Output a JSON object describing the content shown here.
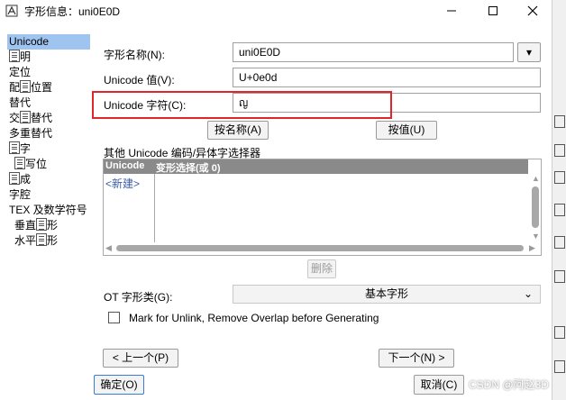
{
  "window": {
    "title": "字形信息：uni0E0D",
    "controls": {
      "minimize": "—",
      "maximize": "☐",
      "close": "✕"
    }
  },
  "sidebar": {
    "items": [
      {
        "label": "Unicode",
        "selected": true
      },
      {
        "label": "明",
        "glyph": true
      },
      {
        "label": "定位"
      },
      {
        "label": "位置",
        "prefix": "配",
        "glyph": true
      },
      {
        "label": "替代"
      },
      {
        "label": "替代",
        "prefix": "交",
        "glyph": true
      },
      {
        "label": "多重替代"
      },
      {
        "label": "字",
        "glyph": true
      },
      {
        "label": "写位",
        "glyph": true,
        "indent": true
      },
      {
        "label": "成",
        "glyph": true
      },
      {
        "label": "字腔"
      },
      {
        "label": "TEX 及数学符号"
      },
      {
        "label": "形",
        "prefix": "垂直",
        "glyph": true,
        "indent": true
      },
      {
        "label": "形",
        "prefix": "水平",
        "glyph": true,
        "indent": true
      }
    ]
  },
  "form": {
    "glyph_name_label": "字形名称(N):",
    "glyph_name_value": "uni0E0D",
    "glyph_name_dropdown": "▾",
    "unicode_value_label": "Unicode 值(V):",
    "unicode_value_value": "U+0e0d",
    "unicode_char_label": "Unicode 字符(C):",
    "unicode_char_value": "ญ",
    "set_from_name_button": "按名称(A)",
    "set_from_value_button": "按值(U)"
  },
  "variation_section": {
    "label": "其他 Unicode 编码/异体字选择器",
    "columns": [
      "Unicode",
      "变形选择(或 0)"
    ],
    "new_row_label": "<新建>",
    "delete_button": "删除"
  },
  "ot_class": {
    "label": "OT 字形类(G):",
    "selected_value": "基本字形"
  },
  "unlink_checkbox": {
    "label": "Mark for Unlink, Remove Overlap before Generating",
    "checked": false
  },
  "nav": {
    "prev_button": "< 上一个(P)",
    "next_button": "下一个(N) >"
  },
  "footer": {
    "ok_button": "确定(O)",
    "cancel_button": "取消(C)"
  },
  "watermark": "CSDN @阿赵3D"
}
